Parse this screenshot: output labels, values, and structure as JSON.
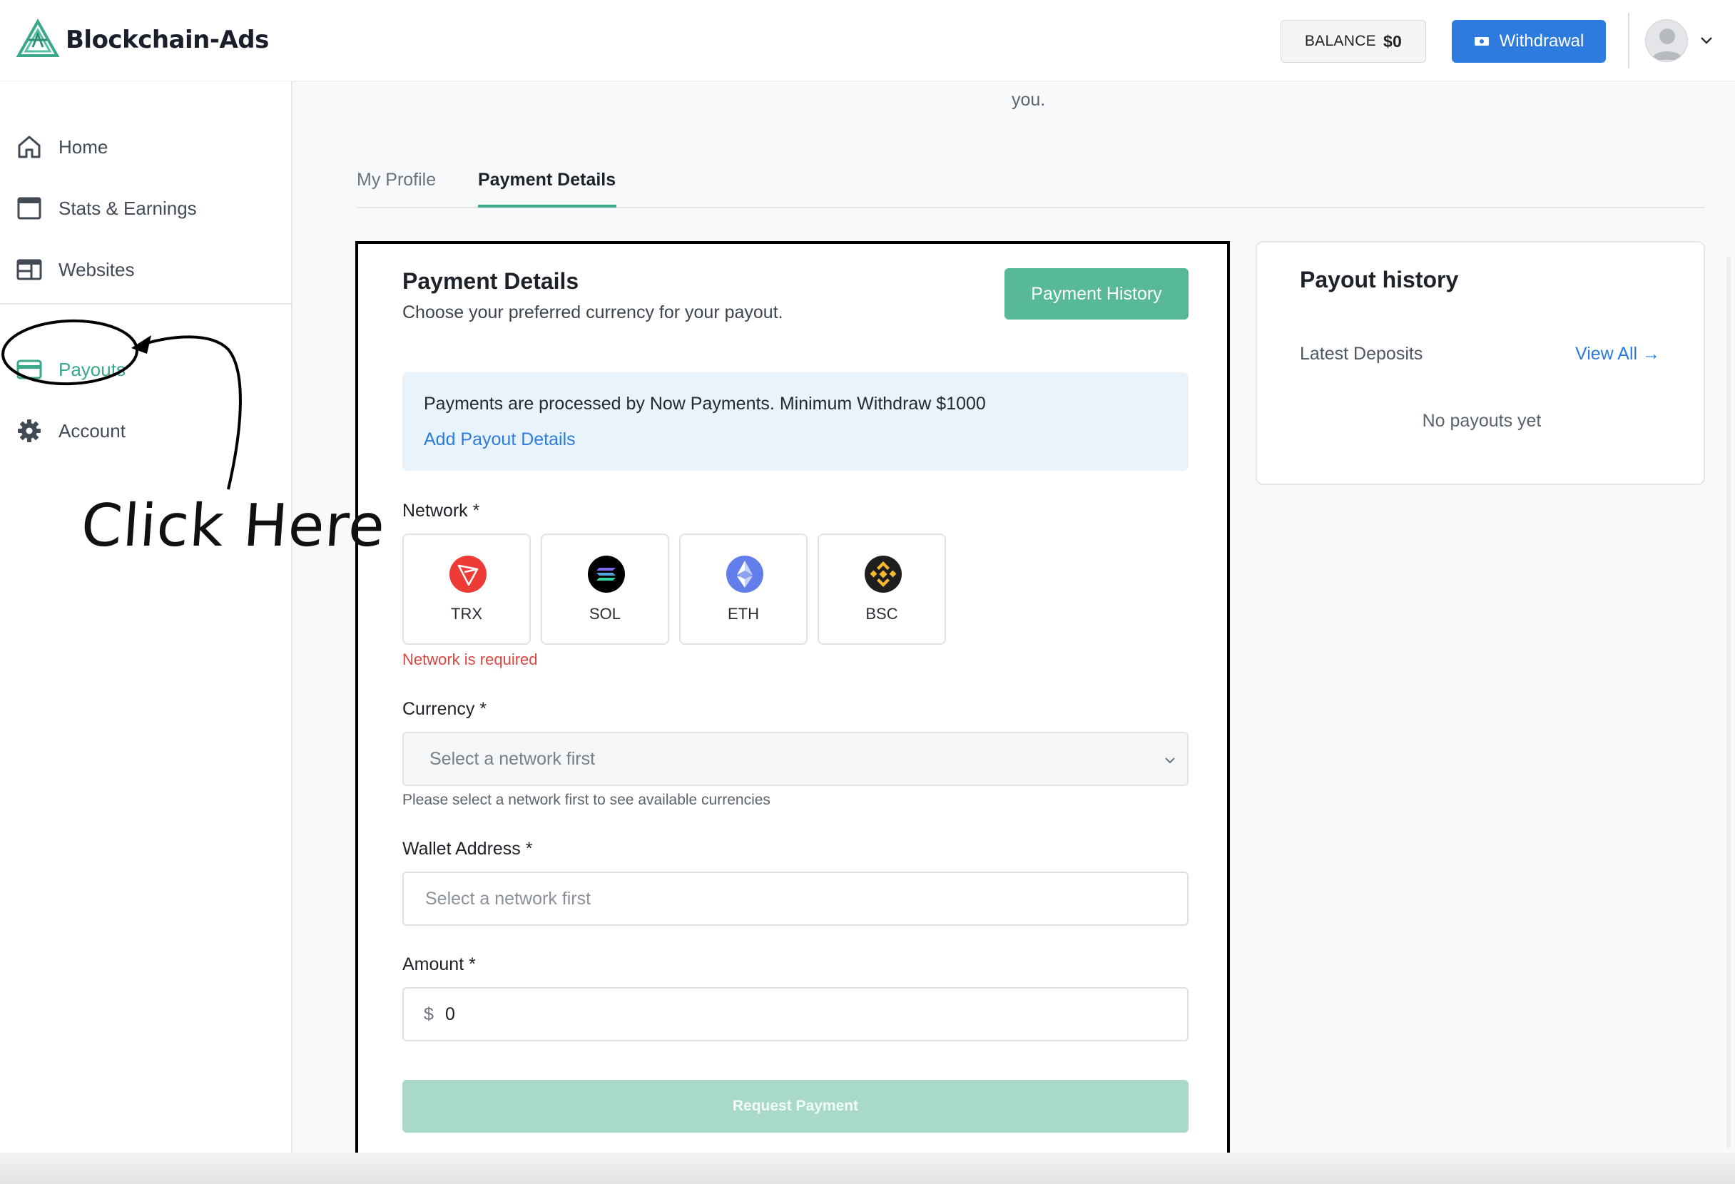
{
  "header": {
    "logo_text": "Blockchain-Ads",
    "balance_label": "BALANCE",
    "balance_value": "$0",
    "withdraw_label": "Withdrawal"
  },
  "sidebar": {
    "items": [
      {
        "label": "Home",
        "icon": "home-icon"
      },
      {
        "label": "Stats & Earnings",
        "icon": "calendar-icon"
      },
      {
        "label": "Websites",
        "icon": "layout-icon"
      },
      {
        "label": "Payouts",
        "icon": "credit-card-icon",
        "active": true
      },
      {
        "label": "Account",
        "icon": "gear-icon"
      }
    ]
  },
  "page": {
    "top_text": "you.",
    "tabs": [
      {
        "label": "My Profile"
      },
      {
        "label": "Payment Details",
        "active": true
      }
    ]
  },
  "payment_card": {
    "title": "Payment Details",
    "subtitle": "Choose your preferred currency for your payout.",
    "history_button": "Payment History",
    "info_text": "Payments are processed by Now Payments. Minimum Withdraw $1000",
    "info_link": "Add Payout Details",
    "network_label": "Network *",
    "networks": [
      {
        "label": "TRX",
        "icon": "tron-icon",
        "color": "#ef3b36"
      },
      {
        "label": "SOL",
        "icon": "solana-icon",
        "color": "#000000"
      },
      {
        "label": "ETH",
        "icon": "ethereum-icon",
        "color": "#627eea"
      },
      {
        "label": "BSC",
        "icon": "bnb-icon",
        "color": "#f3ba2f"
      }
    ],
    "network_error": "Network is required",
    "currency_label": "Currency *",
    "currency_placeholder": "Select a network first",
    "currency_help": "Please select a network first to see available currencies",
    "wallet_label": "Wallet Address *",
    "wallet_placeholder": "Select a network first",
    "amount_label": "Amount *",
    "amount_prefix": "$",
    "amount_value": "0",
    "request_button": "Request Payment"
  },
  "history_card": {
    "title": "Payout history",
    "subtitle": "Latest Deposits",
    "view_all": "View All →",
    "empty_text": "No payouts yet"
  },
  "annotation": {
    "text": "Click Here"
  },
  "colors": {
    "accent": "#3aa98a",
    "primary_blue": "#2e7be0",
    "error": "#d9473f"
  }
}
